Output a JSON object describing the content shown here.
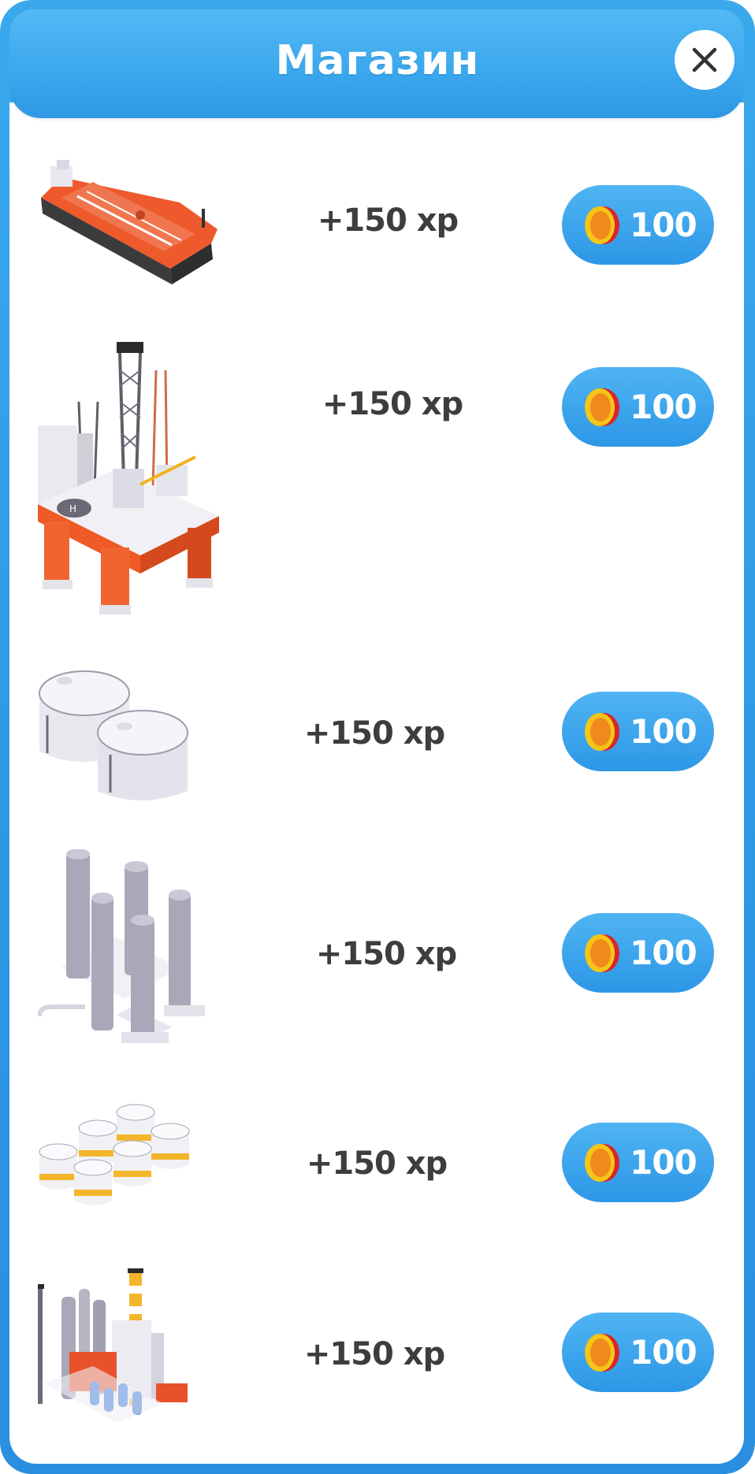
{
  "shop": {
    "title": "Магазин",
    "items": [
      {
        "name": "tanker-ship",
        "reward": "+150 xp",
        "price": "100"
      },
      {
        "name": "oil-platform",
        "reward": "+150 xp",
        "price": "100"
      },
      {
        "name": "storage-tanks",
        "reward": "+150 xp",
        "price": "100"
      },
      {
        "name": "distillation-columns",
        "reward": "+150 xp",
        "price": "100"
      },
      {
        "name": "tank-farm",
        "reward": "+150 xp",
        "price": "100"
      },
      {
        "name": "refinery",
        "reward": "+150 xp",
        "price": "100"
      }
    ]
  },
  "icons": {
    "close": "close-icon",
    "currency": "coin-icon"
  },
  "colors": {
    "frame_blue": "#2f9ae6",
    "header_blue": "#3aa6ec",
    "button_blue": "#2d97e6",
    "text_dark": "#3d3d3d",
    "accent_orange": "#e8552b",
    "coin_gold": "#f5c518"
  }
}
